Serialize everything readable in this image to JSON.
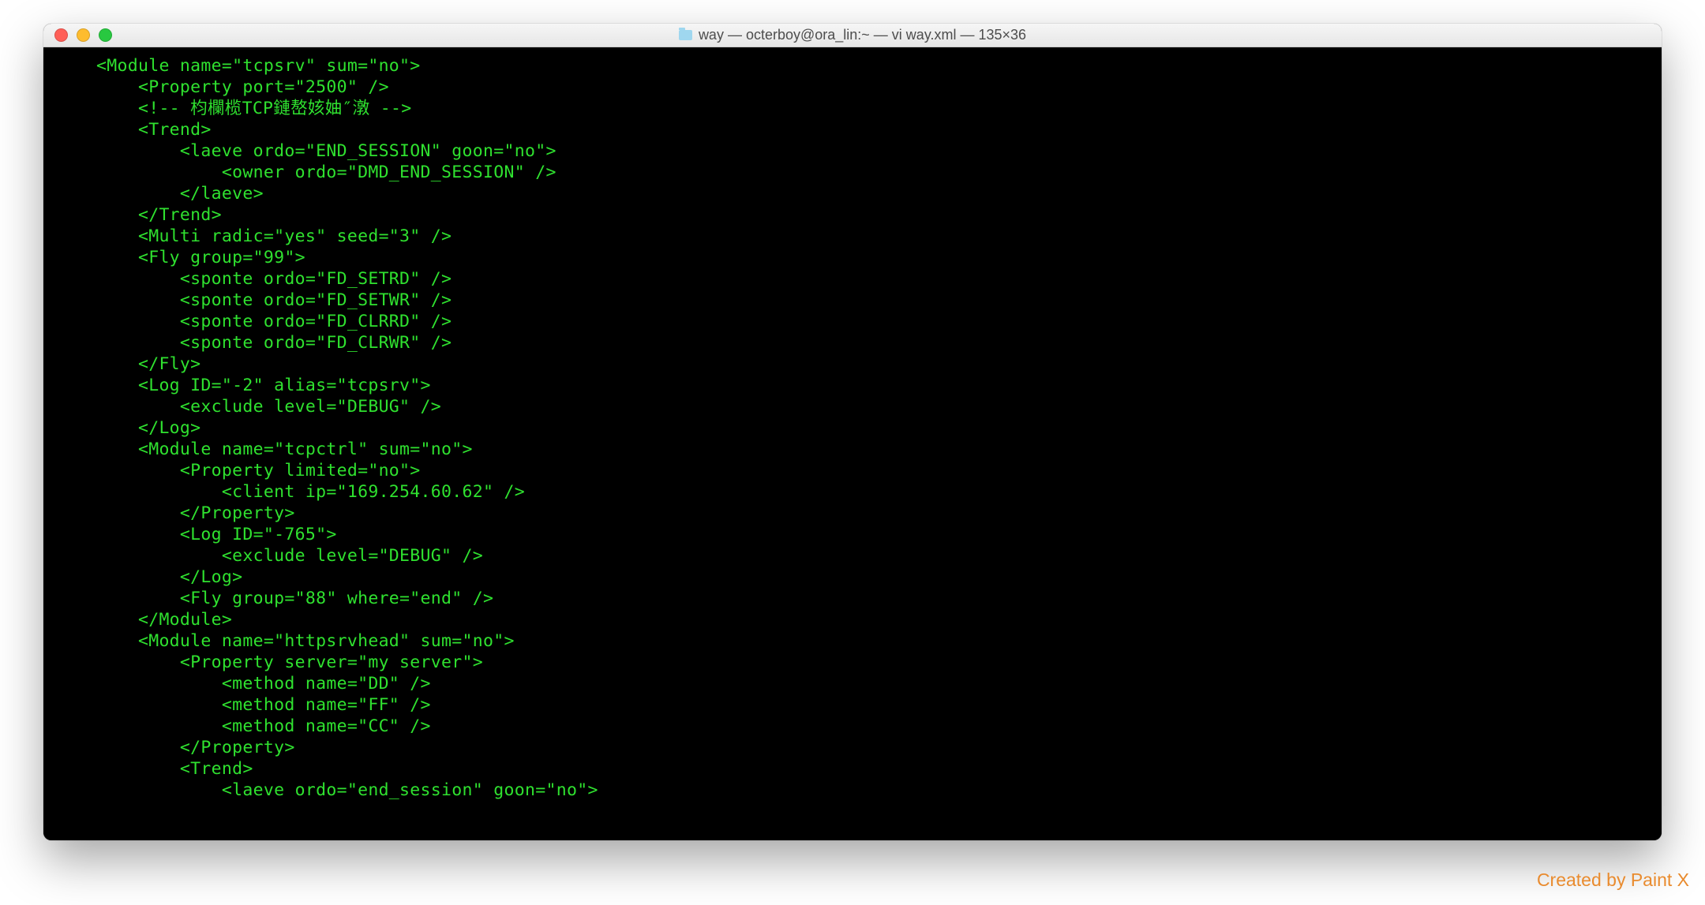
{
  "window": {
    "title": "way — octerboy@ora_lin:~ — vi way.xml — 135×36"
  },
  "terminal": {
    "lines": [
      "    <Module name=\"tcpsrv\" sum=\"no\">",
      "        <Property port=\"2500\" />",
      "        <!-- 枃欄榄TCP鏈嶅姟妯″潡 -->",
      "        <Trend>",
      "            <laeve ordo=\"END_SESSION\" goon=\"no\">",
      "                <owner ordo=\"DMD_END_SESSION\" />",
      "            </laeve>",
      "        </Trend>",
      "        <Multi radic=\"yes\" seed=\"3\" />",
      "        <Fly group=\"99\">",
      "            <sponte ordo=\"FD_SETRD\" />",
      "            <sponte ordo=\"FD_SETWR\" />",
      "            <sponte ordo=\"FD_CLRRD\" />",
      "            <sponte ordo=\"FD_CLRWR\" />",
      "        </Fly>",
      "        <Log ID=\"-2\" alias=\"tcpsrv\">",
      "            <exclude level=\"DEBUG\" />",
      "        </Log>",
      "        <Module name=\"tcpctrl\" sum=\"no\">",
      "            <Property limited=\"no\">",
      "                <client ip=\"169.254.60.62\" />",
      "            </Property>",
      "            <Log ID=\"-765\">",
      "                <exclude level=\"DEBUG\" />",
      "            </Log>",
      "            <Fly group=\"88\" where=\"end\" />",
      "        </Module>",
      "        <Module name=\"httpsrvhead\" sum=\"no\">",
      "            <Property server=\"my server\">",
      "                <method name=\"DD\" />",
      "                <method name=\"FF\" />",
      "                <method name=\"CC\" />",
      "            </Property>",
      "            <Trend>",
      "                <laeve ordo=\"end_session\" goon=\"no\">"
    ]
  },
  "watermark": "Created by Paint X"
}
